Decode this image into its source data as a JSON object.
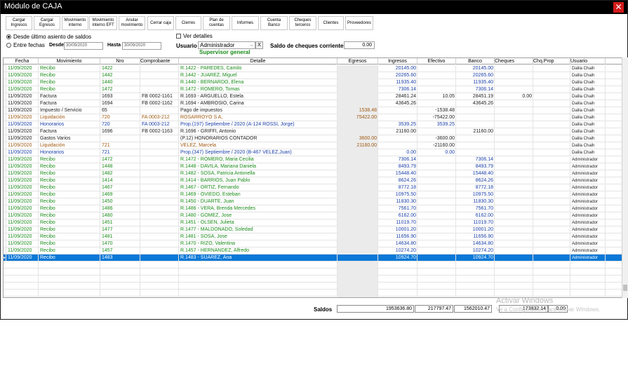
{
  "window": {
    "title": "Módulo de CAJA"
  },
  "toolbar": [
    {
      "name": "cargar-ingresos-button",
      "label": "Cargar\nIngresos"
    },
    {
      "name": "cargar-egresos-button",
      "label": "Cargar\nEgresos"
    },
    {
      "name": "movimiento-interno-button",
      "label": "Movimiento\ninterno"
    },
    {
      "name": "movimiento-interno-eft-button",
      "label": "Movimiento\ninterno EFT"
    },
    {
      "name": "anular-movimiento-button",
      "label": "Anular\nmovimiento"
    },
    {
      "name": "cerrar-caja-button",
      "label": "Cerrar caja"
    },
    {
      "name": "cierres-button",
      "label": "Cierres"
    },
    {
      "name": "plan-de-cuentas-button",
      "label": "Plan de\ncuentas"
    },
    {
      "name": "informes-button",
      "label": "Informes"
    },
    {
      "name": "cuenta-banco-button",
      "label": "Cuenta\nBanco"
    },
    {
      "name": "cheques-terceros-button",
      "label": "Cheques\nterceros"
    },
    {
      "name": "clientes-button",
      "label": "Clientes"
    },
    {
      "name": "proveedores-button",
      "label": "Proveedores"
    }
  ],
  "filters": {
    "desde_ultimo_label": "Desde último asiento de saldos",
    "entre_fechas_label": "Entre fechas",
    "desde_label": "Desde",
    "desde_value": "30/09/2020",
    "hasta_label": "Hasta",
    "hasta_value": "30/09/2020",
    "ver_detalles_label": "Ver detalles",
    "usuario_label": "Usuario",
    "usuario_value": "Administrador",
    "usuario_clear": "X",
    "usuario_role": "Supervisor general",
    "saldo_cheques_label": "Saldo de cheques corrientes",
    "saldo_cheques_value": "0.00"
  },
  "columns": [
    "Fecha",
    "Movimiento",
    "Nro",
    "Comprobante",
    "Detalle",
    "Egresos",
    "Ingresos",
    "Efectivo",
    "Banco",
    "Cheques",
    "Chq.Prop",
    "Usuario"
  ],
  "rows": [
    {
      "fecha": "11/09/2020",
      "mov": "Recibo",
      "nro": "1422",
      "comp": "",
      "det": "R.1422 - PAREDES, Camilo",
      "eg": "",
      "ing": "20145.00",
      "efe": "",
      "ban": "20145.00",
      "chq": "",
      "chqp": "",
      "usr": "Dalila Chaih",
      "color": "green"
    },
    {
      "fecha": "11/09/2020",
      "mov": "Recibo",
      "nro": "1442",
      "comp": "",
      "det": "R.1442 - JUAREZ, Miguel",
      "eg": "",
      "ing": "20265.60",
      "efe": "",
      "ban": "20265.60",
      "chq": "",
      "chqp": "",
      "usr": "Dalila Chaih",
      "color": "green"
    },
    {
      "fecha": "11/09/2020",
      "mov": "Recibo",
      "nro": "1440",
      "comp": "",
      "det": "R.1440 - BERNARDO, Elena",
      "eg": "",
      "ing": "11935.40",
      "efe": "",
      "ban": "11935.40",
      "chq": "",
      "chqp": "",
      "usr": "Dalila Chaih",
      "color": "green"
    },
    {
      "fecha": "11/09/2020",
      "mov": "Recibo",
      "nro": "1472",
      "comp": "",
      "det": "R.1472 - ROMERO, Tomas",
      "eg": "",
      "ing": "7306.14",
      "efe": "",
      "ban": "7306.14",
      "chq": "",
      "chqp": "",
      "usr": "Dalila Chaih",
      "color": "green"
    },
    {
      "fecha": "11/09/2020",
      "mov": "Factura",
      "nro": "1693",
      "comp": "FB 0002-1161",
      "det": "R.1693 - ARGUELLO, Estela",
      "eg": "",
      "ing": "28461.24",
      "efe": "10.05",
      "ban": "28451.19",
      "chq": "0.00",
      "chqp": "",
      "usr": "Dalila Chaih",
      "color": "black"
    },
    {
      "fecha": "11/09/2020",
      "mov": "Factura",
      "nro": "1694",
      "comp": "FB 0002-1162",
      "det": "R.1694 - AMBROSIO, Carina",
      "eg": "",
      "ing": "43645.26",
      "efe": "",
      "ban": "43645.26",
      "chq": "",
      "chqp": "",
      "usr": "Dalila Chaih",
      "color": "black"
    },
    {
      "fecha": "11/09/2020",
      "mov": "Impuesto / Servicio",
      "nro": "65",
      "comp": "",
      "det": "Pago de impuestos",
      "eg": "1538.48",
      "ing": "",
      "efe": "-1538.48",
      "ban": "",
      "chq": "",
      "chqp": "",
      "usr": "Dalila Chaih",
      "color": "black"
    },
    {
      "fecha": "11/09/2020",
      "mov": "Liquidación",
      "nro": "720",
      "comp": "FA 0003-212",
      "det": "ROSARROYO S A,",
      "eg": "75422.00",
      "ing": "",
      "efe": "-75422.00",
      "ban": "",
      "chq": "",
      "chqp": "",
      "usr": "Dalila Chaih",
      "color": "brown"
    },
    {
      "fecha": "11/09/2020",
      "mov": "Honorarios",
      "nro": "720",
      "comp": "FA 0003-212",
      "det": "Prop.(197) Septiembre / 2020 (A-124 ROSSI, Jorge)",
      "eg": "",
      "ing": "3539.25",
      "efe": "3539.25",
      "ban": "",
      "chq": "",
      "chqp": "",
      "usr": "Dalila Chaih",
      "color": "blue"
    },
    {
      "fecha": "11/09/2020",
      "mov": "Factura",
      "nro": "1696",
      "comp": "FB 0002-1163",
      "det": "R.1696 - GRIFFI, Antonio",
      "eg": "",
      "ing": "21160.00",
      "efe": "",
      "ban": "21160.00",
      "chq": "",
      "chqp": "",
      "usr": "Dalila Chaih",
      "color": "black"
    },
    {
      "fecha": "11/09/2020",
      "mov": "Gastos Varios",
      "nro": "",
      "comp": "",
      "det": "(P.12) HONORARIOS CONTADOR",
      "eg": "3600.00",
      "ing": "",
      "efe": "-3600.00",
      "ban": "",
      "chq": "",
      "chqp": "",
      "usr": "Dalila Chaih",
      "color": "black"
    },
    {
      "fecha": "11/09/2020",
      "mov": "Liquidación",
      "nro": "721",
      "comp": "",
      "det": "VELEZ, Marcela",
      "eg": "21160.00",
      "ing": "",
      "efe": "-21160.00",
      "ban": "",
      "chq": "",
      "chqp": "",
      "usr": "Dalila Chaih",
      "color": "brown"
    },
    {
      "fecha": "11/09/2020",
      "mov": "Honorarios",
      "nro": "721",
      "comp": "",
      "det": "Prop.(347) Septiembre / 2020 (B-467 VELEZ,Juan)",
      "eg": "",
      "ing": "0.00",
      "efe": "0.00",
      "ban": "",
      "chq": "",
      "chqp": "",
      "usr": "Dalila Chaih",
      "color": "blue"
    },
    {
      "fecha": "11/09/2020",
      "mov": "Recibo",
      "nro": "1472",
      "comp": "",
      "det": "R.1472 - ROMERO, Maria Cecilia",
      "eg": "",
      "ing": "7306.14",
      "efe": "",
      "ban": "7306.14",
      "chq": "",
      "chqp": "",
      "usr": "Administrador",
      "color": "green"
    },
    {
      "fecha": "11/09/2020",
      "mov": "Recibo",
      "nro": "1448",
      "comp": "",
      "det": "R.1448 - DAVILA, Mariana Daniela",
      "eg": "",
      "ing": "8493.79",
      "efe": "",
      "ban": "8493.79",
      "chq": "",
      "chqp": "",
      "usr": "Administrador",
      "color": "green"
    },
    {
      "fecha": "11/09/2020",
      "mov": "Recibo",
      "nro": "1482",
      "comp": "",
      "det": "R.1482 - SOSA, Patricia Antonella",
      "eg": "",
      "ing": "15448.40",
      "efe": "",
      "ban": "15448.40",
      "chq": "",
      "chqp": "",
      "usr": "Administrador",
      "color": "green"
    },
    {
      "fecha": "11/09/2020",
      "mov": "Recibo",
      "nro": "1414",
      "comp": "",
      "det": "R.1414 - BARRIOS, Juan Pablo",
      "eg": "",
      "ing": "8624.26",
      "efe": "",
      "ban": "8624.26",
      "chq": "",
      "chqp": "",
      "usr": "Administrador",
      "color": "green"
    },
    {
      "fecha": "11/09/2020",
      "mov": "Recibo",
      "nro": "1467",
      "comp": "",
      "det": "R.1467 - ORTIZ, Fernando",
      "eg": "",
      "ing": "8772.18",
      "efe": "",
      "ban": "8772.18",
      "chq": "",
      "chqp": "",
      "usr": "Administrador",
      "color": "green"
    },
    {
      "fecha": "11/09/2020",
      "mov": "Recibo",
      "nro": "1469",
      "comp": "",
      "det": "R.1469 - OVIEDO, Esteban",
      "eg": "",
      "ing": "10975.50",
      "efe": "",
      "ban": "10975.50",
      "chq": "",
      "chqp": "",
      "usr": "Administrador",
      "color": "green"
    },
    {
      "fecha": "11/09/2020",
      "mov": "Recibo",
      "nro": "1450",
      "comp": "",
      "det": "R.1450 - DUARTE, Juan",
      "eg": "",
      "ing": "11830.30",
      "efe": "",
      "ban": "11830.30",
      "chq": "",
      "chqp": "",
      "usr": "Administrador",
      "color": "green"
    },
    {
      "fecha": "11/09/2020",
      "mov": "Recibo",
      "nro": "1486",
      "comp": "",
      "det": "R.1486 - VERA, Brenda Mercedes",
      "eg": "",
      "ing": "7561.70",
      "efe": "",
      "ban": "7561.70",
      "chq": "",
      "chqp": "",
      "usr": "Administrador",
      "color": "green"
    },
    {
      "fecha": "11/09/2020",
      "mov": "Recibo",
      "nro": "1480",
      "comp": "",
      "det": "R.1480 - GOMEZ, Jose",
      "eg": "",
      "ing": "6162.00",
      "efe": "",
      "ban": "6162.00",
      "chq": "",
      "chqp": "",
      "usr": "Administrador",
      "color": "green"
    },
    {
      "fecha": "11/09/2020",
      "mov": "Recibo",
      "nro": "1451",
      "comp": "",
      "det": "R.1451 - OLSEN, Julieta",
      "eg": "",
      "ing": "11019.70",
      "efe": "",
      "ban": "11019.70",
      "chq": "",
      "chqp": "",
      "usr": "Administrador",
      "color": "green"
    },
    {
      "fecha": "11/09/2020",
      "mov": "Recibo",
      "nro": "1477",
      "comp": "",
      "det": "R.1477 - MALDONADO, Soledad",
      "eg": "",
      "ing": "10001.20",
      "efe": "",
      "ban": "10001.20",
      "chq": "",
      "chqp": "",
      "usr": "Administrador",
      "color": "green"
    },
    {
      "fecha": "11/09/2020",
      "mov": "Recibo",
      "nro": "1481",
      "comp": "",
      "det": "R.1481 - SOSA, Jose",
      "eg": "",
      "ing": "11656.90",
      "efe": "",
      "ban": "11656.90",
      "chq": "",
      "chqp": "",
      "usr": "Administrador",
      "color": "green"
    },
    {
      "fecha": "11/09/2020",
      "mov": "Recibo",
      "nro": "1470",
      "comp": "",
      "det": "R.1470 - RIZO, Valentina",
      "eg": "",
      "ing": "14634.80",
      "efe": "",
      "ban": "14634.80",
      "chq": "",
      "chqp": "",
      "usr": "Administrador",
      "color": "green"
    },
    {
      "fecha": "11/09/2020",
      "mov": "Recibo",
      "nro": "1457",
      "comp": "",
      "det": "R.1457 - HERNANDEZ, Alfredo",
      "eg": "",
      "ing": "10274.20",
      "efe": "",
      "ban": "10274.20",
      "chq": "",
      "chqp": "",
      "usr": "Administrador",
      "color": "green"
    },
    {
      "fecha": "11/09/2020",
      "mov": "Recibo",
      "nro": "1483",
      "comp": "",
      "det": "R.1483 - SUAREZ, Ana",
      "eg": "",
      "ing": "10924.70",
      "efe": "",
      "ban": "10924.70",
      "chq": "",
      "chqp": "",
      "usr": "Administrador",
      "color": "green",
      "selected": true
    }
  ],
  "totals": {
    "label": "Saldos",
    "egresos": "1953636.80",
    "ingresos": "217797.47",
    "efectivo": "1562010.47",
    "banco": "173832.14",
    "cheques": "0.00"
  },
  "watermark": {
    "line1": "Activar Windows",
    "line2": "Ve a Configuración para activar Windows."
  },
  "colors": {
    "green": "#1b8c1b",
    "blue": "#1a3fa8",
    "brown": "#a05a12",
    "black": "#1e1e1e",
    "selection": "#0a78d7",
    "close": "#d11a1a"
  }
}
